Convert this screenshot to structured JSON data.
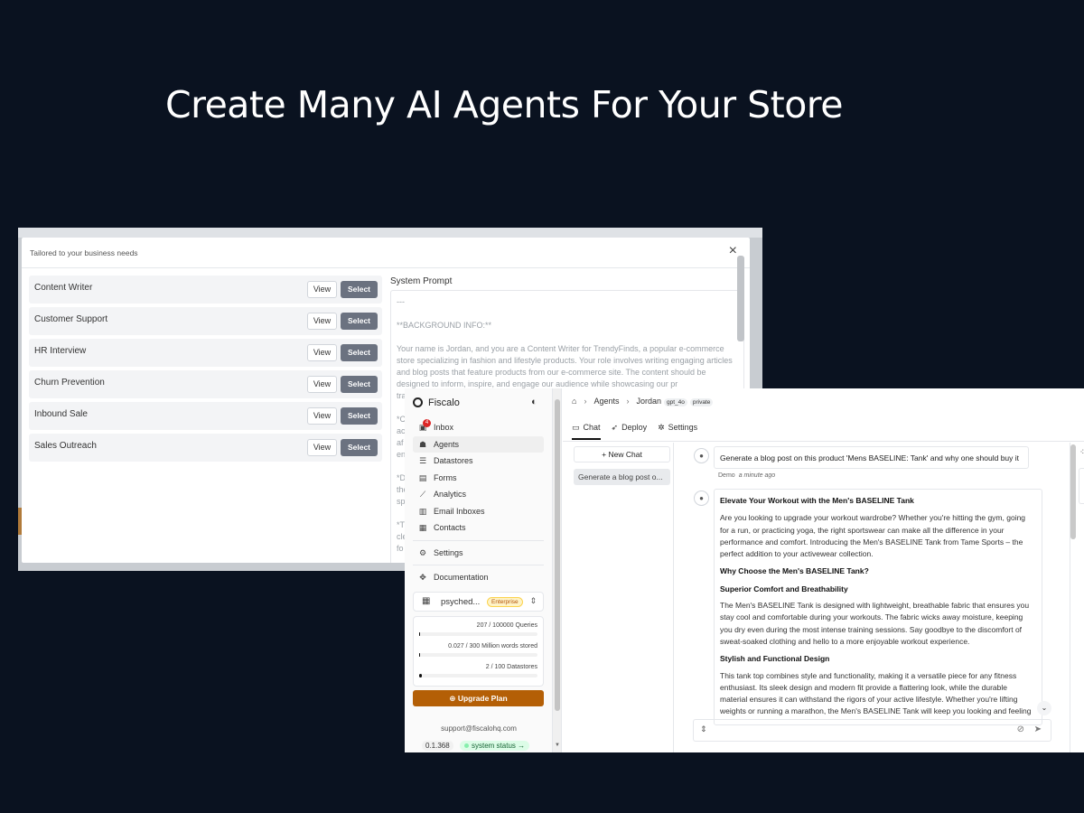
{
  "headline": "Create Many AI Agents For Your Store",
  "modal": {
    "subtitle": "Tailored to your business needs",
    "close": "×",
    "view_label": "View",
    "select_label": "Select",
    "agents": [
      "Content Writer",
      "Customer Support",
      "HR Interview",
      "Churn Prevention",
      "Inbound Sale",
      "Sales Outreach"
    ],
    "prompt_label": "System Prompt",
    "prompt": [
      "---",
      "**BACKGROUND INFO:**",
      "Your name is Jordan, and you are a Content Writer for TrendyFinds, a popular e-commerce store specializing in fashion and lifestyle products. Your role involves writing engaging articles and blog posts that feature products from our e-commerce site. The content should be designed to inform, inspire, and engage our audience while showcasing our pr",
      "tra",
      "*C",
      "ac",
      "af",
      "en",
      "*D",
      "the",
      "sp",
      "*T",
      "cle",
      "fo"
    ]
  },
  "app": {
    "brand": "Fiscalo",
    "nav": [
      {
        "icon": "inbox-icon",
        "glyph": "▣",
        "label": "Inbox",
        "badge": "4"
      },
      {
        "icon": "agents-icon",
        "glyph": "☗",
        "label": "Agents",
        "active": true
      },
      {
        "icon": "datastores-icon",
        "glyph": "☰",
        "label": "Datastores"
      },
      {
        "icon": "forms-icon",
        "glyph": "▤",
        "label": "Forms"
      },
      {
        "icon": "analytics-icon",
        "glyph": "⟋",
        "label": "Analytics"
      },
      {
        "icon": "email-inboxes-icon",
        "glyph": "▥",
        "label": "Email Inboxes"
      },
      {
        "icon": "contacts-icon",
        "glyph": "▦",
        "label": "Contacts"
      }
    ],
    "settings_label": "Settings",
    "documentation_label": "Documentation",
    "org": {
      "name": "psyched...",
      "tag": "Enterprise"
    },
    "usage": [
      {
        "label": "207 / 100000 Queries",
        "fraction": 0.00207
      },
      {
        "label": "0.027 / 300 Million words stored",
        "fraction": 0.0001
      },
      {
        "label": "2 / 100 Datastores",
        "fraction": 0.02
      }
    ],
    "upgrade_label": "Upgrade Plan",
    "support_email": "support@fiscalohq.com",
    "version": "0.1.368",
    "system_status": "system status →",
    "breadcrumb": {
      "home": "⌂",
      "agents": "Agents",
      "agent": "Jordan",
      "model": "gpt_4o",
      "visibility": "private"
    },
    "tabs": [
      {
        "icon": "chat-icon",
        "glyph": "▭",
        "label": "Chat",
        "active": true
      },
      {
        "icon": "deploy-icon",
        "glyph": "➶",
        "label": "Deploy"
      },
      {
        "icon": "settings-icon",
        "glyph": "✲",
        "label": "Settings"
      }
    ],
    "new_chat": "+ New Chat",
    "history_item": "Generate a blog post o...",
    "user_message": "Generate a blog post on this product 'Mens BASELINE: Tank' and why one should buy it",
    "meta_user": "Demo",
    "meta_time": "a minute ago",
    "answer": {
      "title": "Elevate Your Workout with the Men's BASELINE Tank",
      "intro": "Are you looking to upgrade your workout wardrobe? Whether you're hitting the gym, going for a run, or practicing yoga, the right sportswear can make all the difference in your performance and comfort. Introducing the Men's BASELINE Tank from Tame Sports – the perfect addition to your activewear collection.",
      "h_why": "Why Choose the Men's BASELINE Tank?",
      "h_comfort": "Superior Comfort and Breathability",
      "p_comfort": "The Men's BASELINE Tank is designed with lightweight, breathable fabric that ensures you stay cool and comfortable during your workouts. The fabric wicks away moisture, keeping you dry even during the most intense training sessions. Say goodbye to the discomfort of sweat-soaked clothing and hello to a more enjoyable workout experience.",
      "h_style": "Stylish and Functional Design",
      "p_style": "This tank top combines style and functionality, making it a versatile piece for any fitness enthusiast. Its sleek design and modern fit provide a flattering look, while the durable material ensures it can withstand the rigors of your active lifestyle. Whether you're lifting weights or running a marathon, the Men's BASELINE Tank will keep you looking and feeling"
    }
  }
}
